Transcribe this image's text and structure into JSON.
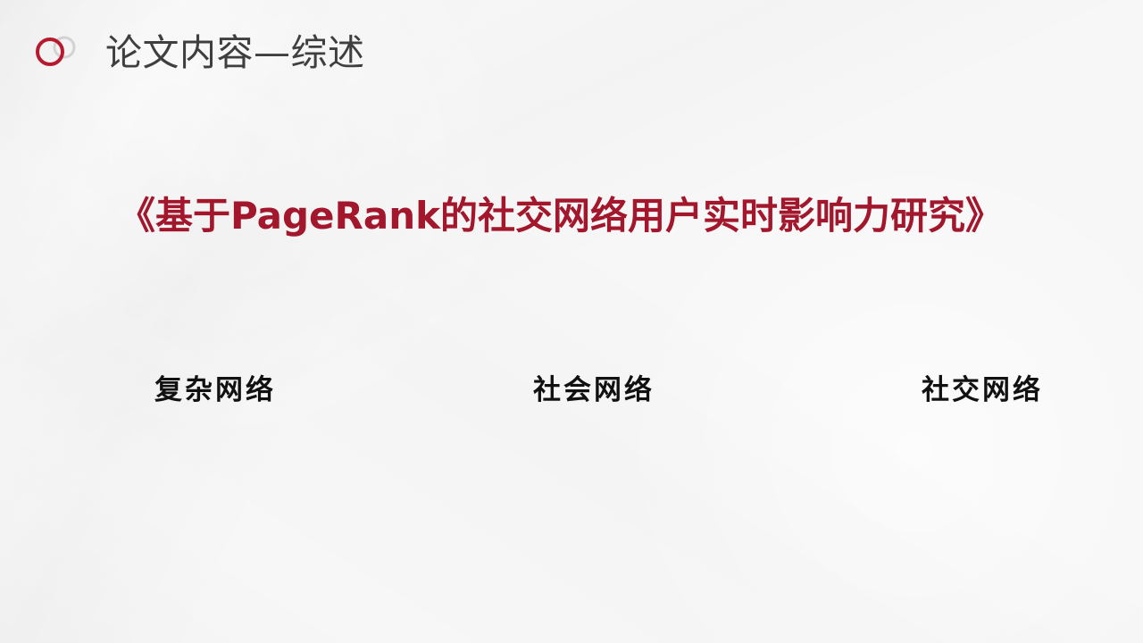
{
  "header": {
    "title": "论文内容—综述",
    "icon": "overlapping-circles-icon",
    "accent_color": "#b7192f",
    "secondary_color": "#cfcfcf"
  },
  "main": {
    "paper_title": "《基于PageRank的社交网络用户实时影响力研究》",
    "keywords": [
      "复杂网络",
      "社会网络",
      "社交网络"
    ]
  }
}
